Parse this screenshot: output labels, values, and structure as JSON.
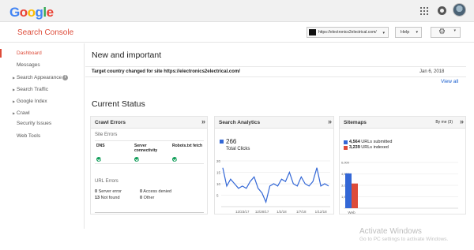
{
  "topbar": {
    "logo": {
      "G": "G",
      "o1": "o",
      "o2": "o",
      "g": "g",
      "l": "l",
      "e": "e"
    },
    "icons": [
      "apps-icon",
      "notifications-icon",
      "avatar"
    ]
  },
  "header": {
    "product_title": "Search Console",
    "property": "https://electronics2electrical.com/",
    "help_label": "Help",
    "caret": "▾",
    "gear": "⚙"
  },
  "sidebar": {
    "items": [
      {
        "label": "Dashboard",
        "active": true,
        "expandable": false
      },
      {
        "label": "Messages",
        "active": false,
        "expandable": false
      },
      {
        "label": "Search Appearance",
        "active": false,
        "expandable": true,
        "info": "i"
      },
      {
        "label": "Search Traffic",
        "active": false,
        "expandable": true
      },
      {
        "label": "Google Index",
        "active": false,
        "expandable": true
      },
      {
        "label": "Crawl",
        "active": false,
        "expandable": true
      },
      {
        "label": "Security Issues",
        "active": false,
        "expandable": false
      },
      {
        "label": "Web Tools",
        "active": false,
        "expandable": false
      }
    ]
  },
  "main": {
    "new_title": "New and important",
    "message": {
      "text": "Target country changed for site https://electronics2electrical.com/",
      "date": "Jan 6, 2018"
    },
    "view_all": "View all",
    "status_title": "Current Status"
  },
  "crawl_errors": {
    "title": "Crawl Errors",
    "arrows": "»",
    "site_errors": "Site Errors",
    "columns": [
      "DNS",
      "Server connectivity",
      "Robots.txt fetch"
    ],
    "url_errors": "URL Errors",
    "rows": [
      {
        "count": "0",
        "label": "Server error"
      },
      {
        "count": "13",
        "label": "Not found"
      },
      {
        "count": "0",
        "label": "Access denied"
      },
      {
        "count": "0",
        "label": "Other"
      }
    ]
  },
  "search_analytics": {
    "title": "Search Analytics",
    "arrows": "»",
    "total": "266",
    "total_label": "Total Clicks",
    "accent": "#3367d6"
  },
  "sitemaps": {
    "title": "Sitemaps",
    "arrows": "»",
    "sort": "By me (3)",
    "submitted_count": "4,564",
    "submitted_label": "URLs submitted",
    "indexed_count": "3,239",
    "indexed_label": "URLs indexed",
    "submitted_color": "#3367d6",
    "indexed_color": "#dd4b39"
  },
  "chart_data": [
    {
      "type": "line",
      "title": "",
      "x_tick_labels": [
        "12/23/17",
        "12/28/17",
        "1/2/18",
        "1/7/18",
        "1/12/18"
      ],
      "y_tick_labels": [
        "20",
        "15",
        "10",
        "5"
      ],
      "ylim": [
        0,
        20
      ],
      "grid": true,
      "series": [
        {
          "values": [
            17,
            9,
            12,
            10,
            8,
            9,
            8,
            11,
            13,
            8,
            6,
            2,
            9,
            10,
            9,
            12,
            11,
            15,
            10,
            9,
            13,
            10,
            9,
            11,
            17,
            9,
            10,
            9
          ]
        }
      ]
    },
    {
      "type": "bar",
      "title": "",
      "categories": [
        "Web"
      ],
      "y_tick_labels": [
        "6,000",
        "4,500",
        "3,000",
        "1,500"
      ],
      "ylim": [
        0,
        6000
      ],
      "series": [
        {
          "name": "URLs submitted",
          "values": [
            4564
          ]
        },
        {
          "name": "URLs indexed",
          "values": [
            3239
          ]
        }
      ]
    }
  ],
  "watermark": {
    "line1": "Activate Windows",
    "line2": "Go to PC settings to activate Windows."
  }
}
